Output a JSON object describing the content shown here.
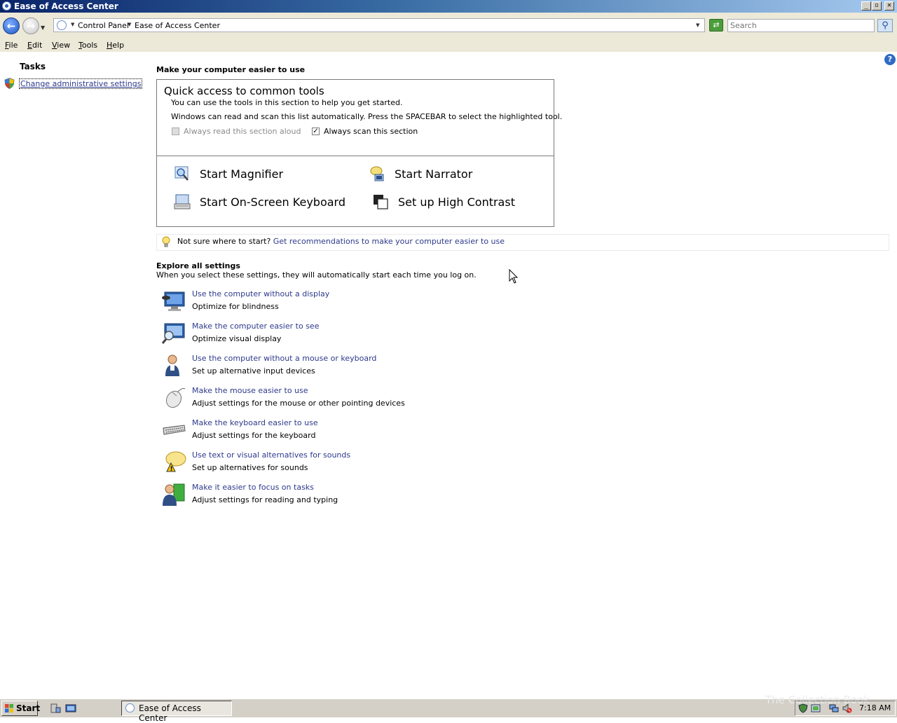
{
  "window": {
    "title": "Ease of Access Center",
    "controls": {
      "minimize": "_",
      "restore": "▫",
      "close": "✕"
    }
  },
  "address": {
    "breadcrumbs": [
      "Control Panel",
      "Ease of Access Center"
    ],
    "search_placeholder": "Search"
  },
  "menu": [
    {
      "label": "File",
      "accel": "F"
    },
    {
      "label": "Edit",
      "accel": "E"
    },
    {
      "label": "View",
      "accel": "V"
    },
    {
      "label": "Tools",
      "accel": "T"
    },
    {
      "label": "Help",
      "accel": "H"
    }
  ],
  "sidebar": {
    "title": "Tasks",
    "link": "Change administrative settings"
  },
  "main": {
    "heading": "Make your computer easier to use",
    "quick": {
      "title": "Quick access to common tools",
      "desc1": "You can use the tools in this section to help you get started.",
      "desc2": "Windows can read and scan this list automatically.  Press the SPACEBAR to select the highlighted tool.",
      "read_aloud": {
        "label": "Always read this section aloud",
        "checked": false,
        "disabled": true
      },
      "scan": {
        "label": "Always scan this section",
        "checked": true
      },
      "tools": [
        {
          "label": "Start Magnifier",
          "icon": "magnifier-icon"
        },
        {
          "label": "Start Narrator",
          "icon": "narrator-icon"
        },
        {
          "label": "Start On-Screen Keyboard",
          "icon": "keyboard-icon"
        },
        {
          "label": "Set up High Contrast",
          "icon": "contrast-icon"
        }
      ]
    },
    "tip": {
      "prefix": "Not sure where to start? ",
      "link": "Get recommendations to make your computer easier to use"
    },
    "explore": {
      "heading": "Explore all settings",
      "desc": "When you select these settings, they will automatically start each time you log on.",
      "items": [
        {
          "link": "Use the computer without a display",
          "sub": "Optimize for blindness",
          "icon": "monitor-blind-icon"
        },
        {
          "link": "Make the computer easier to see",
          "sub": "Optimize visual display",
          "icon": "monitor-magnify-icon"
        },
        {
          "link": "Use the computer without a mouse or keyboard",
          "sub": "Set up alternative input devices",
          "icon": "user-input-icon"
        },
        {
          "link": "Make the mouse easier to use",
          "sub": "Adjust settings for the mouse or other pointing devices",
          "icon": "mouse-icon"
        },
        {
          "link": "Make the keyboard easier to use",
          "sub": "Adjust settings for the keyboard",
          "icon": "keyboard-icon"
        },
        {
          "link": "Use text or visual alternatives for sounds",
          "sub": "Set up alternatives for sounds",
          "icon": "speech-bubble-warning-icon"
        },
        {
          "link": "Make it easier to focus on tasks",
          "sub": "Adjust settings for reading and typing",
          "icon": "user-focus-icon"
        }
      ]
    }
  },
  "taskbar": {
    "start": "Start",
    "task": "Ease of Access Center",
    "clock": "7:18 AM",
    "watermark": "The Collection Book"
  },
  "colors": {
    "link": "#2d3a8c",
    "titlebar_start": "#0a246a",
    "titlebar_end": "#a6caf0",
    "chrome": "#ece9d8"
  }
}
